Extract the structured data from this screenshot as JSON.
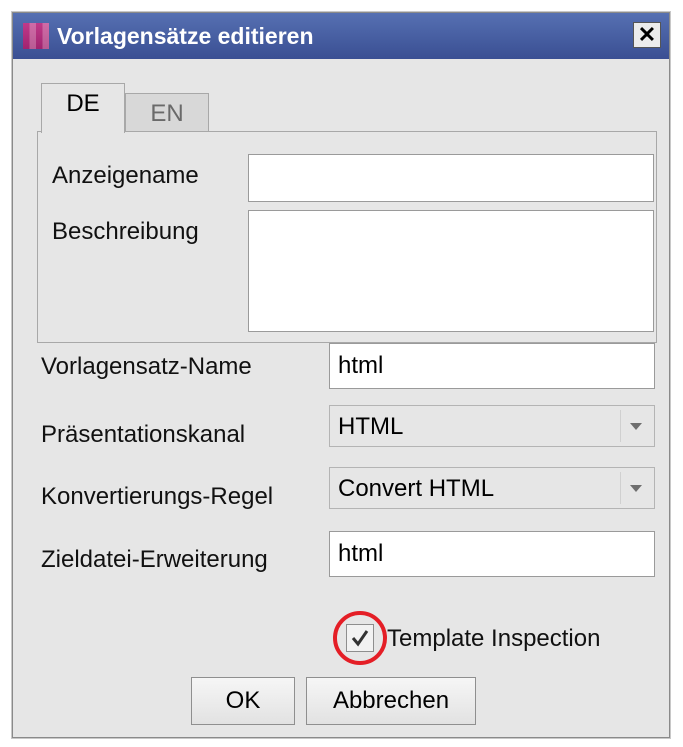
{
  "window": {
    "title": "Vorlagensätze editieren",
    "close_symbol": "✕"
  },
  "tabs": [
    {
      "label": "DE",
      "active": true
    },
    {
      "label": "EN",
      "active": false
    }
  ],
  "localized": {
    "display_name_label": "Anzeigename",
    "display_name_value": "",
    "description_label": "Beschreibung",
    "description_value": ""
  },
  "form": {
    "template_set_name_label": "Vorlagensatz-Name",
    "template_set_name_value": "html",
    "presentation_channel_label": "Präsentationskanal",
    "presentation_channel_value": "HTML",
    "conversion_rule_label": "Konvertierungs-Regel",
    "conversion_rule_value": "Convert HTML",
    "target_extension_label": "Zieldatei-Erweiterung",
    "target_extension_value": "html"
  },
  "template_inspection": {
    "label": "Template Inspection",
    "checked": true
  },
  "buttons": {
    "ok": "OK",
    "cancel": "Abbrechen"
  },
  "colors": {
    "titlebar": "#3a4f93",
    "highlight_ring": "#e41e26",
    "dialog_background": "#e6e6e6"
  },
  "icons": {
    "app": "app-icon",
    "close": "close-icon",
    "dropdown": "chevron-down-icon",
    "check": "checkmark-icon"
  }
}
